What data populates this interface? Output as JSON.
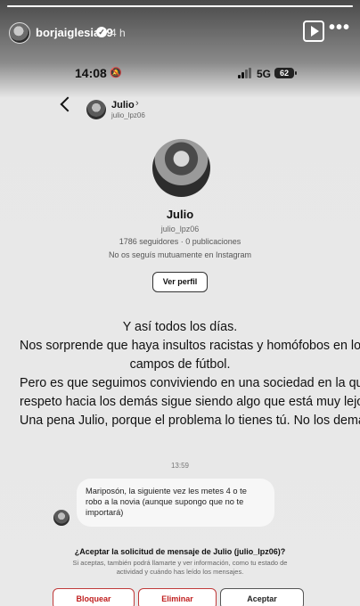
{
  "story": {
    "username": "borjaiglesias9",
    "time_ago": "4 h",
    "progress": 1.0,
    "icons": [
      "verified-icon",
      "play-icon",
      "more-icon"
    ]
  },
  "status_bar": {
    "time": "14:08",
    "network": "5G",
    "battery": "62"
  },
  "dm_header": {
    "name": "Julio",
    "chevron": "›",
    "handle": "julio_lpz06"
  },
  "profile": {
    "name": "Julio",
    "handle": "julio_lpz06",
    "stats": "1786 seguidores · 0 publicaciones",
    "mutual": "No os seguís mutuamente en Instagram",
    "view_button": "Ver perfil"
  },
  "caption": {
    "lines": [
      "Y así todos los días.",
      "Nos sorprende que haya insultos racistas y homófobos en los",
      "campos de fútbol.",
      "Pero es que seguimos conviviendo en una sociedad en la que el",
      "respeto hacia los demás sigue siendo algo que está muy lejos.",
      "Una pena Julio, porque el problema lo tienes tú. No los demás."
    ]
  },
  "conversation": {
    "timestamp": "13:59",
    "message": "Mariposón, la siguiente vez les metes 4 o te robo a la novia (aunque supongo que no te importará)"
  },
  "request": {
    "title": "¿Aceptar la solicitud de mensaje de Julio (julio_lpz06)?",
    "description": "Si aceptas, también podrá llamarte y ver información, como tu estado de actividad y cuándo has leído los mensajes.",
    "block_label": "Bloquear",
    "delete_label": "Eliminar",
    "accept_label": "Aceptar"
  },
  "colors": {
    "danger": "#c02020",
    "text": "#111111",
    "background": "#e9e9e9"
  }
}
